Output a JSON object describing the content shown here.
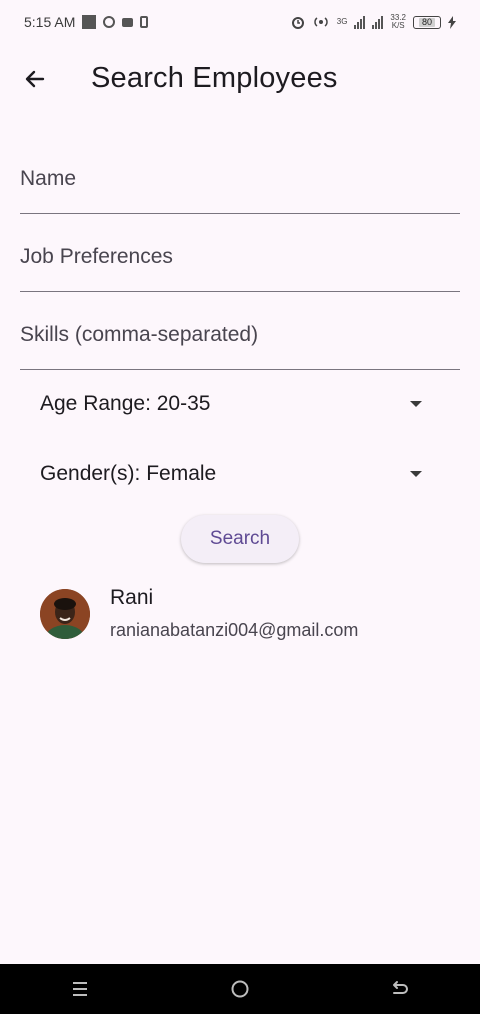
{
  "status_bar": {
    "time": "5:15 AM",
    "net_3g": "3G",
    "speed_top": "33.2",
    "speed_bottom": "K/S",
    "battery": "80"
  },
  "app_bar": {
    "title": "Search Employees"
  },
  "form": {
    "name_placeholder": "Name",
    "job_placeholder": "Job Preferences",
    "skills_placeholder": "Skills (comma-separated)",
    "age_range": "Age Range: 20-35",
    "genders": "Gender(s): Female",
    "search_label": "Search"
  },
  "results": [
    {
      "name": "Rani",
      "email": "ranianabatanzi004@gmail.com"
    }
  ],
  "colors": {
    "background": "#fdf7fc",
    "accent": "#5f4a94"
  }
}
